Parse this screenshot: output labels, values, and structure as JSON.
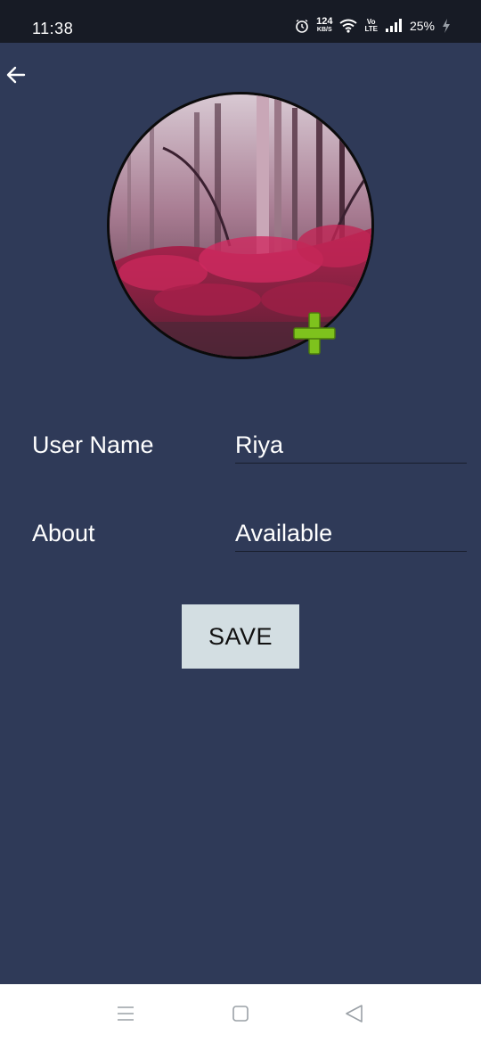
{
  "status_bar": {
    "time": "11:38",
    "net_speed_value": "124",
    "net_speed_unit": "KB/S",
    "volte_top": "Vo",
    "volte_bottom": "LTE",
    "battery_percent": "25%"
  },
  "profile": {
    "username_label": "User Name",
    "username_value": "Riya",
    "about_label": "About",
    "about_value": "Available"
  },
  "actions": {
    "save_label": "SAVE"
  },
  "colors": {
    "background": "#2f3a58",
    "status_bar": "#171b25",
    "save_button": "#d3dee2",
    "add_icon": "#7ec21d"
  },
  "icons": {
    "back": "arrow-left-icon",
    "add_photo": "plus-icon",
    "nav_menu": "menu-icon",
    "nav_home": "square-home-icon",
    "nav_back": "triangle-back-icon"
  }
}
